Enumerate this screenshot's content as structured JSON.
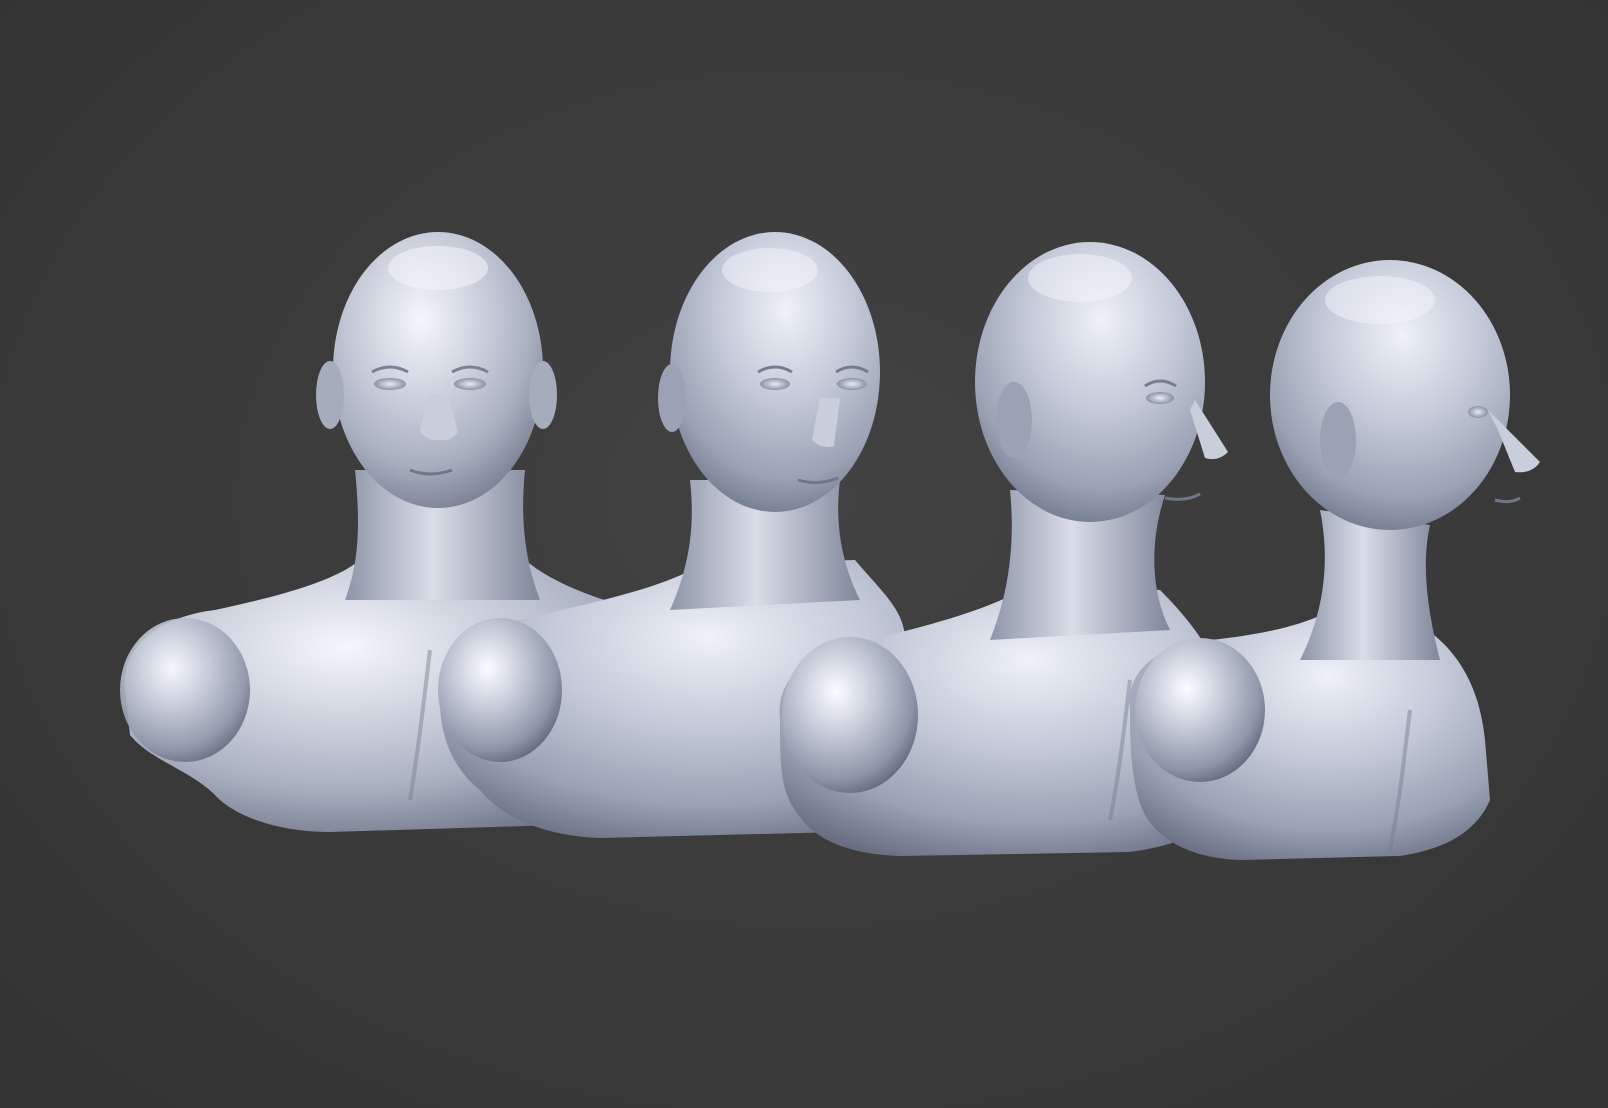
{
  "scene": {
    "background_color": "#3a3a3a",
    "material_highlight": "#f4f6fb",
    "material_base": "#b9bfcd",
    "material_shadow": "#6f7689",
    "bust_count": 4,
    "busts": [
      {
        "view": "front"
      },
      {
        "view": "three-quarter-left"
      },
      {
        "view": "three-quarter-right"
      },
      {
        "view": "right-profile"
      }
    ]
  }
}
